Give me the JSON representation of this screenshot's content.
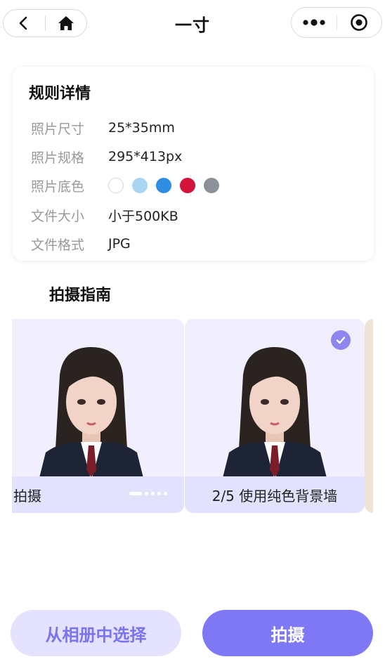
{
  "header": {
    "title": "一寸",
    "back_icon": "chevron-left-icon",
    "home_icon": "home-icon",
    "more_icon": "more-dots-icon",
    "close_icon": "target-circle-icon"
  },
  "rules": {
    "title": "规则详情",
    "rows": [
      {
        "label": "照片尺寸",
        "value": "25*35mm"
      },
      {
        "label": "照片规格",
        "value": "295*413px"
      },
      {
        "label": "照片底色",
        "value": ""
      },
      {
        "label": "文件大小",
        "value": "小于500KB"
      },
      {
        "label": "文件格式",
        "value": "JPG"
      }
    ],
    "background_colors": [
      "#ffffff",
      "#a9d4f2",
      "#2f8ee3",
      "#d2143a",
      "#8c9198"
    ]
  },
  "guide": {
    "title": "拍摄指南",
    "slides": [
      {
        "caption": "拍摄"
      },
      {
        "caption": "2/5 使用纯色背景墙"
      }
    ],
    "pager": {
      "total": 5,
      "active": 1
    }
  },
  "buttons": {
    "album": "从相册中选择",
    "shoot": "拍摄"
  },
  "colors": {
    "accent": "#7e78f5",
    "accent_light": "#e4e2fd",
    "card_bg": "#f1effd"
  }
}
